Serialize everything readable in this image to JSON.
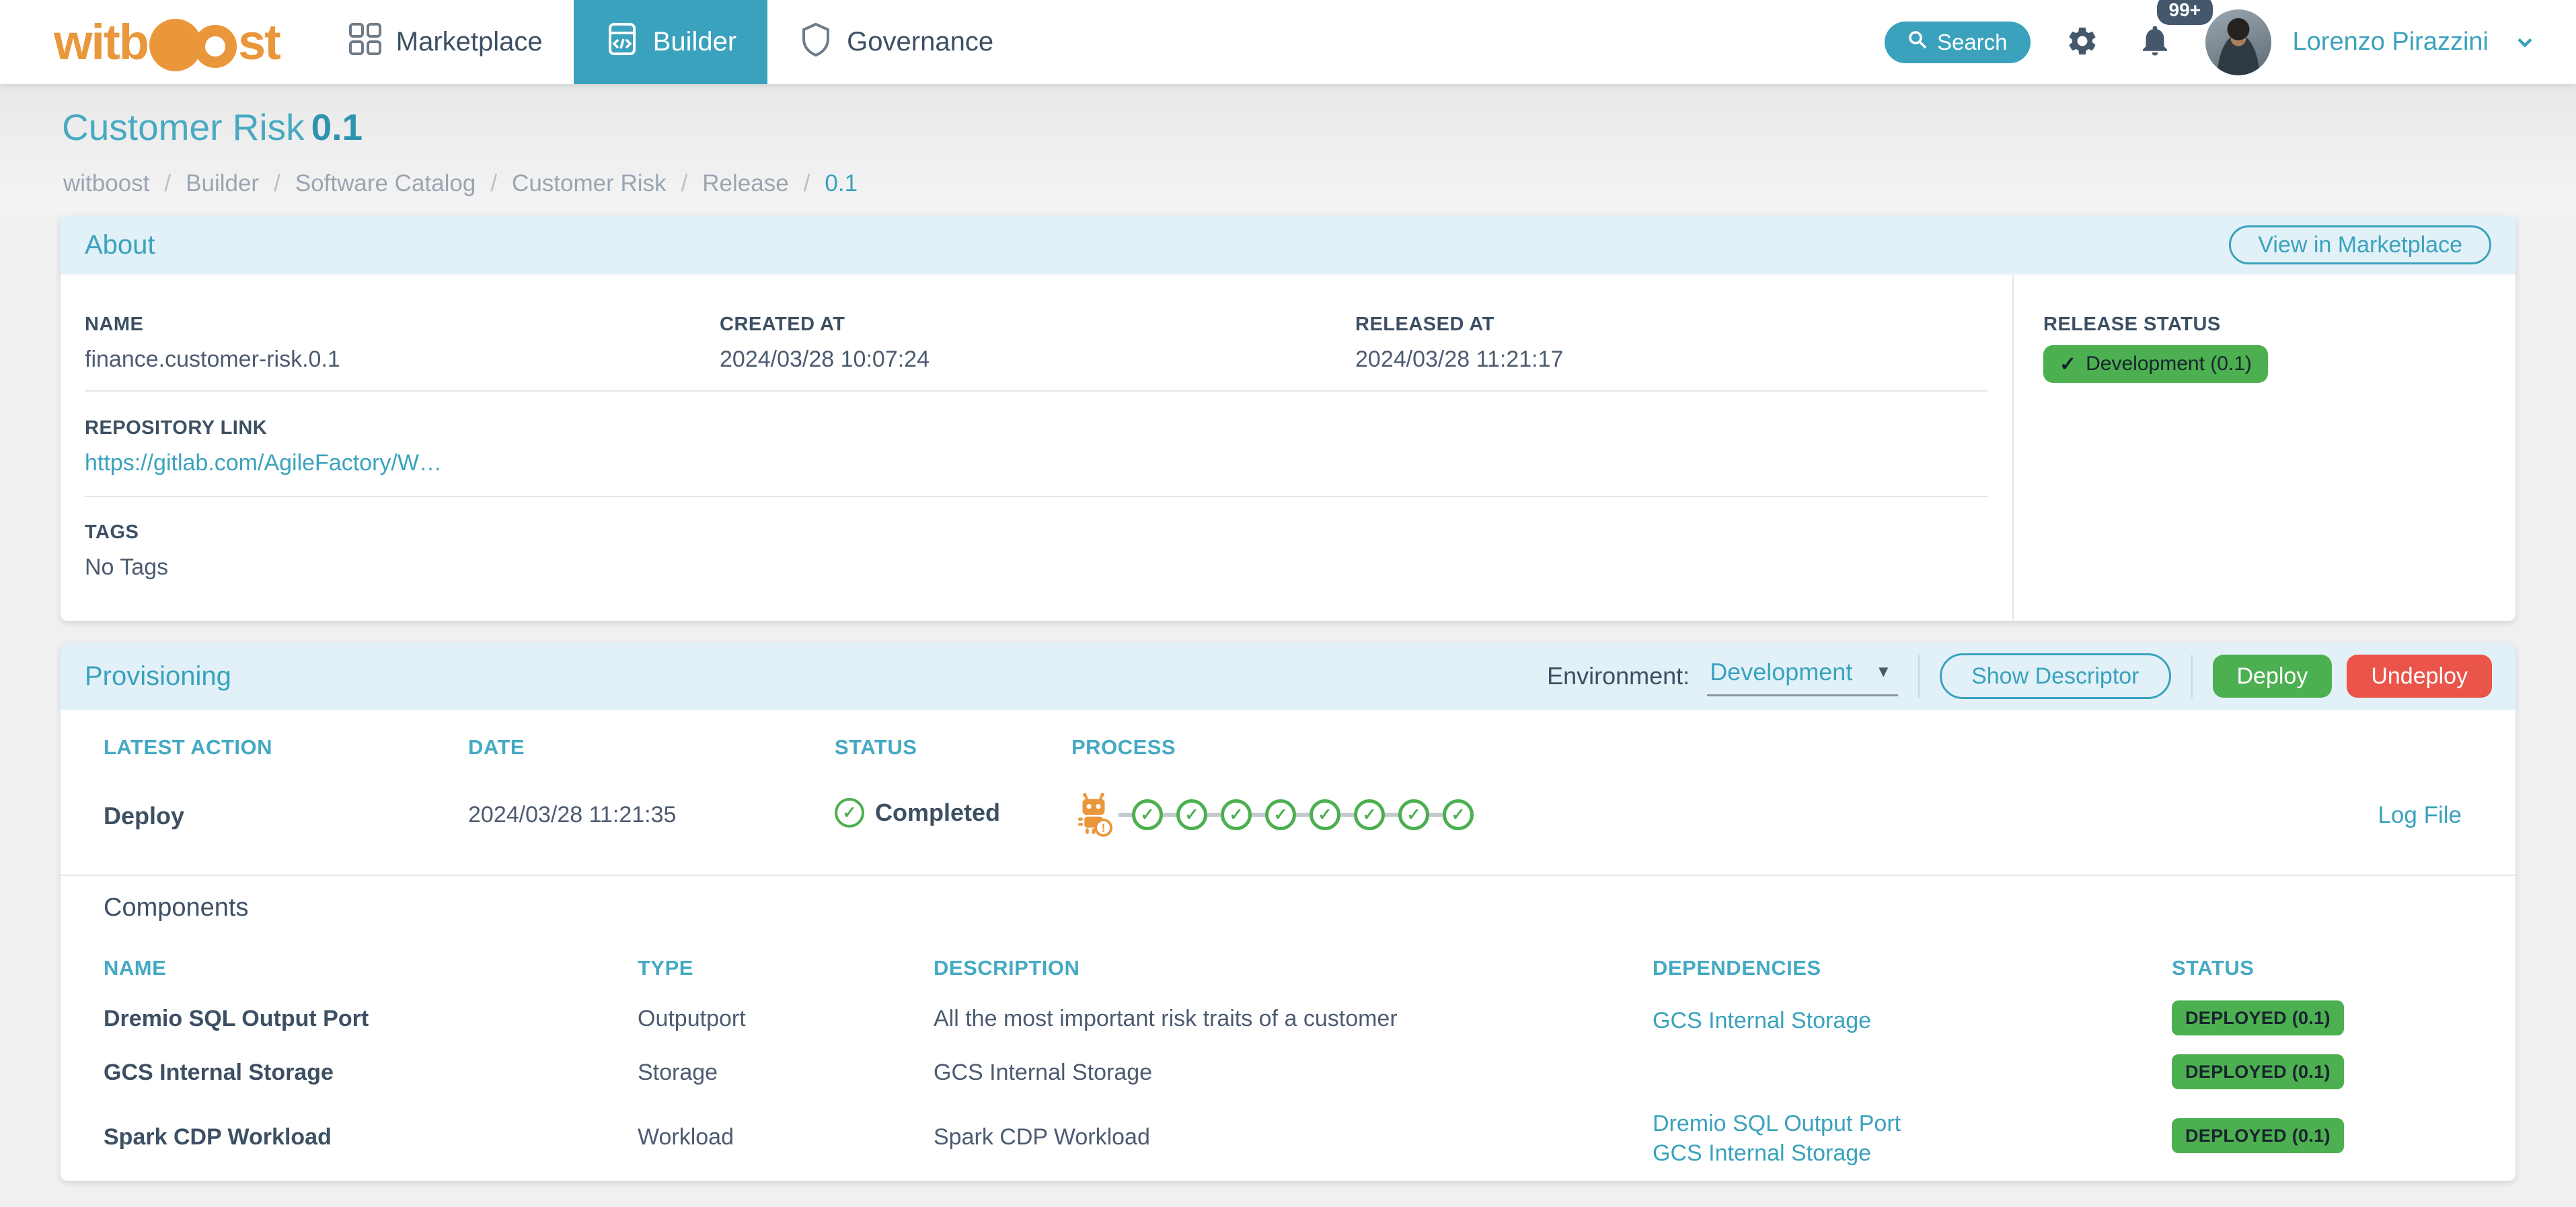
{
  "colors": {
    "accent": "#3aa2bd",
    "accent_dark": "#2e93ae",
    "header_bg": "#e2f1f8",
    "navy": "#3d4f63",
    "text": "#4c5b70",
    "muted": "#9aa5b1",
    "green": "#4caf50",
    "red": "#ea5449",
    "orange": "#ea973c",
    "slate": "#44576b",
    "page_bg": "#f0f0f1",
    "divider": "#e3e6e9"
  },
  "nav": {
    "logo_text_left": "witb",
    "logo_text_right": "st",
    "items": [
      {
        "label": "Marketplace",
        "icon": "grid-icon"
      },
      {
        "label": "Builder",
        "icon": "code-window-icon"
      },
      {
        "label": "Governance",
        "icon": "shield-icon"
      }
    ],
    "search_label": "Search",
    "notification_badge": "99+",
    "user_name": "Lorenzo Pirazzini"
  },
  "page": {
    "title": "Customer Risk",
    "version": "0.1",
    "breadcrumb": [
      "witboost",
      "Builder",
      "Software Catalog",
      "Customer Risk",
      "Release",
      "0.1"
    ]
  },
  "about": {
    "title": "About",
    "view_in_marketplace_label": "View in Marketplace",
    "name_label": "NAME",
    "name_value": "finance.customer-risk.0.1",
    "created_label": "CREATED AT",
    "created_value": "2024/03/28 10:07:24",
    "released_label": "RELEASED AT",
    "released_value": "2024/03/28 11:21:17",
    "release_status_label": "RELEASE STATUS",
    "release_status_check": "✓",
    "release_status_value": "Development (0.1)",
    "repository_label": "REPOSITORY LINK",
    "repository_value": "https://gitlab.com/AgileFactory/W…",
    "tags_label": "TAGS",
    "tags_value": "No Tags"
  },
  "provisioning": {
    "title": "Provisioning",
    "environment_label": "Environment:",
    "environment_value": "Development",
    "show_descriptor_label": "Show Descriptor",
    "deploy_label": "Deploy",
    "undeploy_label": "Undeploy",
    "latest_action": {
      "headers": {
        "action": "LATEST ACTION",
        "date": "DATE",
        "status": "STATUS",
        "process": "PROCESS"
      },
      "action": "Deploy",
      "date": "2024/03/28 11:21:35",
      "status": "Completed",
      "process_steps_completed": 8,
      "log_file_label": "Log File"
    },
    "components": {
      "title": "Components",
      "headers": {
        "name": "NAME",
        "type": "TYPE",
        "description": "DESCRIPTION",
        "dependencies": "DEPENDENCIES",
        "status": "STATUS"
      },
      "rows": [
        {
          "name": "Dremio SQL Output Port",
          "type": "Outputport",
          "description": "All the most important risk traits of a customer",
          "dependencies": [
            "GCS Internal Storage"
          ],
          "status": "DEPLOYED (0.1)"
        },
        {
          "name": "GCS Internal Storage",
          "type": "Storage",
          "description": "GCS Internal Storage",
          "dependencies": [],
          "status": "DEPLOYED (0.1)"
        },
        {
          "name": "Spark CDP Workload",
          "type": "Workload",
          "description": "Spark CDP Workload",
          "dependencies": [
            "Dremio SQL Output Port",
            "GCS Internal Storage"
          ],
          "status": "DEPLOYED (0.1)"
        }
      ]
    }
  }
}
